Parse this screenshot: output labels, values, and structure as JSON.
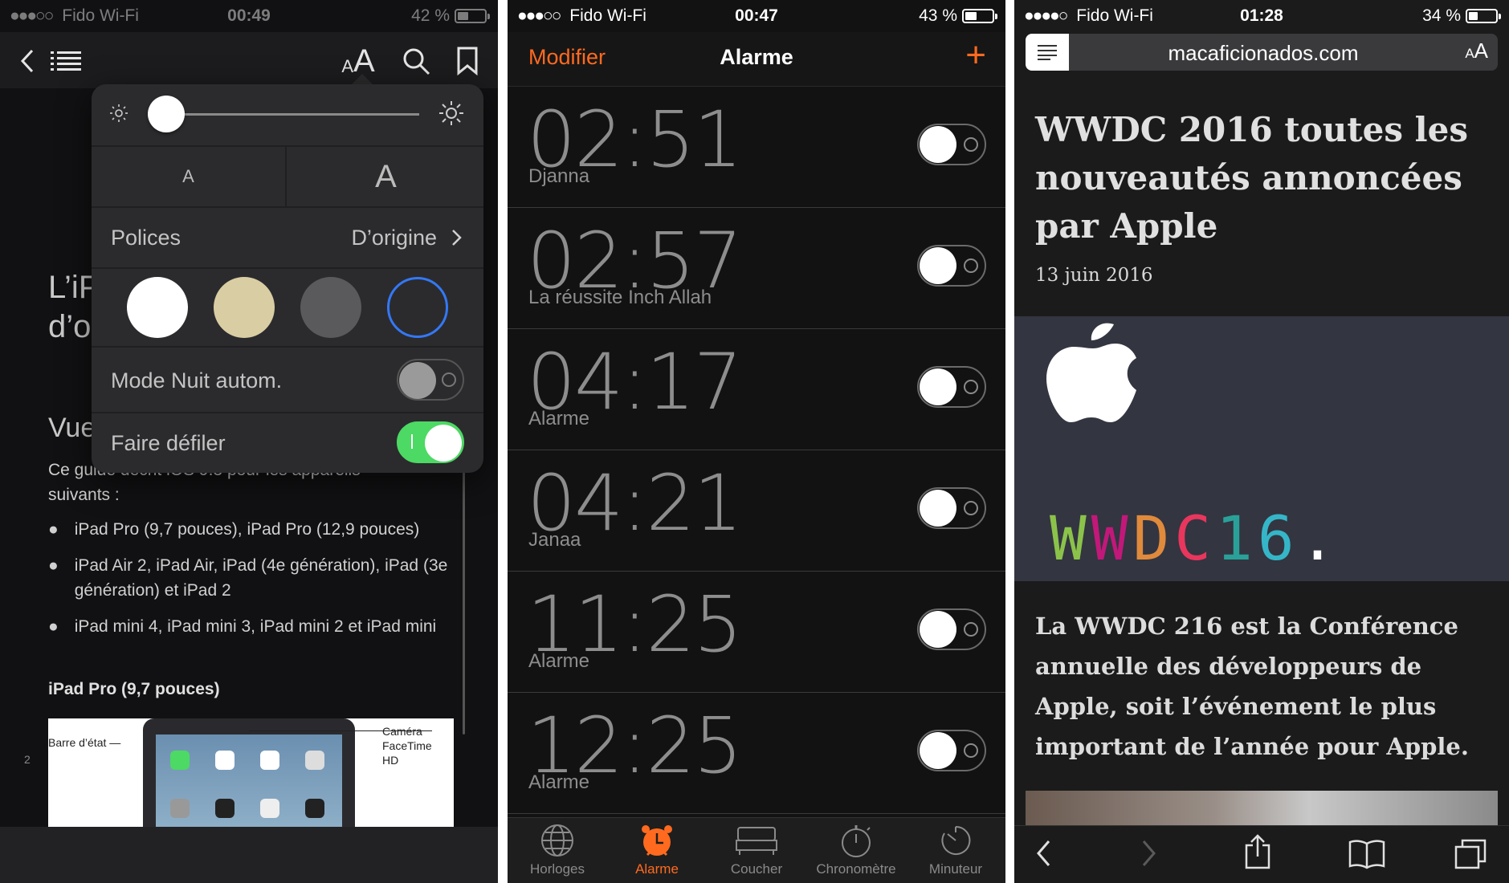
{
  "panel_books": {
    "status": {
      "carrier": "Fido Wi-Fi",
      "time": "00:49",
      "battery": "42 %",
      "battery_level": 0.42
    },
    "toolbar": {
      "text_size_glyph_small": "A",
      "text_size_glyph_large": "A"
    },
    "book": {
      "heading_partial_1": "L’iP",
      "heading_partial_2": "d’o",
      "section_partial": "Vue",
      "intro_line1": "Ce guide décrit iOS 9.3 pour les appareils",
      "intro_line2": "suivants :",
      "bullets": [
        "iPad Pro (9,7 pouces), iPad Pro (12,9 pouces)",
        "iPad Air 2, iPad Air, iPad (4e génération), iPad (3e génération) et iPad 2",
        "iPad mini 4, iPad mini 3, iPad mini 2 et iPad mini"
      ],
      "subheading": "iPad Pro (9,7 pouces)",
      "figure_label_left": "Barre d’état",
      "figure_label_right": "Caméra FaceTime HD",
      "page_number": "2"
    },
    "settings": {
      "brightness": 0.05,
      "font_small": "A",
      "font_large": "A",
      "fonts_label": "Polices",
      "fonts_value": "D’origine",
      "themes": [
        {
          "name": "white",
          "color": "#ffffff"
        },
        {
          "name": "sepia",
          "color": "#d9cda3"
        },
        {
          "name": "gray",
          "color": "#5a5a5c"
        },
        {
          "name": "night",
          "color": "#2b2b2d",
          "selected": true
        }
      ],
      "auto_night_label": "Mode Nuit autom.",
      "auto_night_on": false,
      "scroll_label": "Faire défiler",
      "scroll_on": true
    }
  },
  "panel_alarm": {
    "status": {
      "carrier": "Fido Wi-Fi",
      "time": "00:47",
      "battery": "43 %",
      "battery_level": 0.43
    },
    "nav": {
      "edit": "Modifier",
      "title": "Alarme",
      "add": "+"
    },
    "alarms": [
      {
        "time": "02:51",
        "label": "Djanna",
        "enabled": false
      },
      {
        "time": "02:57",
        "label": "La réussite Inch Allah",
        "enabled": false
      },
      {
        "time": "04:17",
        "label": "Alarme",
        "enabled": false
      },
      {
        "time": "04:21",
        "label": "Janaa",
        "enabled": false
      },
      {
        "time": "11:25",
        "label": "Alarme",
        "enabled": false
      },
      {
        "time": "12:25",
        "label": "Alarme",
        "enabled": false
      }
    ],
    "tabs": [
      {
        "label": "Horloges",
        "icon": "globe-icon"
      },
      {
        "label": "Alarme",
        "icon": "alarm-clock-icon",
        "active": true
      },
      {
        "label": "Coucher",
        "icon": "bed-icon"
      },
      {
        "label": "Chronomètre",
        "icon": "stopwatch-icon"
      },
      {
        "label": "Minuteur",
        "icon": "timer-icon"
      }
    ],
    "accent": "#ff6a1f"
  },
  "panel_safari": {
    "status": {
      "carrier": "Fido Wi-Fi",
      "time": "01:28",
      "battery": "34 %",
      "battery_level": 0.34
    },
    "url": "macaficionados.com",
    "text_size_small": "A",
    "text_size_large": "A",
    "article": {
      "title_lines": [
        "WWDC 2016 toutes les",
        "nouveautés annoncées",
        "par Apple"
      ],
      "date": "13 juin 2016",
      "hero_letters": [
        {
          "char": "W",
          "color": "#8bc34a"
        },
        {
          "char": "W",
          "color": "#c2187a"
        },
        {
          "char": "D",
          "color": "#e08a3c"
        },
        {
          "char": "C",
          "color": "#e8365d"
        },
        {
          "char": "1",
          "color": "#2aa198"
        },
        {
          "char": "6",
          "color": "#35b6c8"
        },
        {
          "char": ".",
          "color": "#ffffff"
        }
      ],
      "body_lines": [
        "La WWDC 216 est la Conférence",
        "annuelle des développeurs de",
        "Apple, soit l’événement le plus",
        "important de l’année pour Apple."
      ]
    }
  }
}
